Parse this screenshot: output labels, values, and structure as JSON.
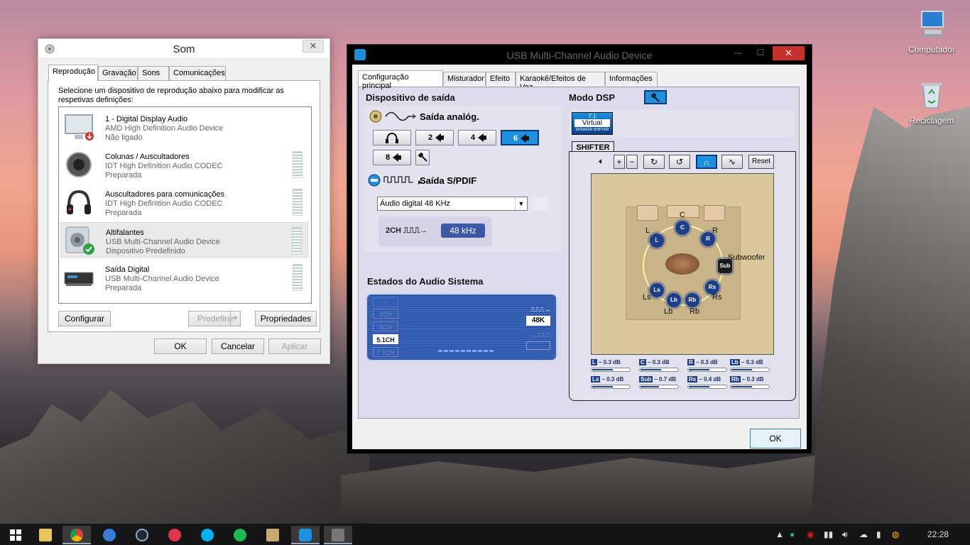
{
  "desktop": {
    "icons": [
      {
        "label": "Computador",
        "icon": "computer-icon"
      },
      {
        "label": "Reciclagem",
        "icon": "recycle-bin-icon"
      }
    ]
  },
  "som": {
    "title": "Som",
    "close": "✕",
    "tabs": [
      "Reprodução",
      "Gravação",
      "Sons",
      "Comunicações"
    ],
    "active_tab": 0,
    "description": "Selecione um dispositivo de reprodução abaixo para modificar as respetivas definições:",
    "devices": [
      {
        "name": "1 - Digital Display Audio",
        "driver": "AMD High Definition Audio Device",
        "status": "Não ligado",
        "icon": "monitor-icon"
      },
      {
        "name": "Colunas / Auscultadores",
        "driver": "IDT High Definition Audio CODEC",
        "status": "Preparada",
        "icon": "speaker-icon"
      },
      {
        "name": "Auscultadores para comunicações",
        "driver": "IDT High Definition Audio CODEC",
        "status": "Preparada",
        "icon": "headphones-icon"
      },
      {
        "name": "Altifalantes",
        "driver": "USB Multi-Channel Audio Device",
        "status": "Dispositivo Predefinido",
        "icon": "speaker-default-icon"
      },
      {
        "name": "Saída Digital",
        "driver": "USB Multi-Channel Audio Device",
        "status": "Preparada",
        "icon": "digital-output-icon"
      }
    ],
    "buttons": {
      "configure": "Configurar",
      "set_default": "Predefinir",
      "properties": "Propriedades",
      "ok": "OK",
      "cancel": "Cancelar",
      "apply": "Aplicar"
    }
  },
  "usb": {
    "title": "USB Multi-Channel Audio Device",
    "tabs": [
      "Configuração principal",
      "Misturador",
      "Efeito",
      "Karaokê/Efeitos de Voz",
      "Informações"
    ],
    "output_device_title": "Dispositivo de saída",
    "analog_label": "Saída analóg.",
    "channel_buttons": [
      "2",
      "4",
      "6",
      "8"
    ],
    "selected_channel": "6",
    "spdif_label": "Saída S/PDIF",
    "spdif_select": "Áudio digital  48 KHz",
    "rate_channels": "2CH",
    "rate_value": "48 kHz",
    "system_state_title": "Estados do Audio Sistema",
    "channel_states": [
      "2CH",
      "4CH",
      "5.1CH",
      "7.1CH"
    ],
    "active_state": "5.1CH",
    "sample_rate_display": "48K",
    "dsp_title": "Modo DSP",
    "virtual_badge": {
      "top": "7.1",
      "mid": "Virtual",
      "bottom": "SPEAKER SHIFTER"
    },
    "shifter_tab": "SHIFTER",
    "reset": "Reset",
    "speakers": {
      "C": "C",
      "L": "L",
      "R": "R",
      "Sub": "Sub",
      "Subwoofer": "Subwoofer",
      "Ls": "Ls",
      "Rs": "Rs",
      "Lb": "Lb",
      "Rb": "Rb"
    },
    "levels": [
      {
        "ch": "L",
        "text": "– 0.3 dB",
        "fill": 0.55
      },
      {
        "ch": "C",
        "text": "– 0.3 dB",
        "fill": 0.55
      },
      {
        "ch": "R",
        "text": "– 0.3 dB",
        "fill": 0.55
      },
      {
        "ch": "Lb",
        "text": "– 0.3 dB",
        "fill": 0.55
      },
      {
        "ch": "Ls",
        "text": "– 0.3 dB",
        "fill": 0.55
      },
      {
        "ch": "Sub",
        "text": "– 0.7 dB",
        "fill": 0.5
      },
      {
        "ch": "Rs",
        "text": "– 0.4 dB",
        "fill": 0.55
      },
      {
        "ch": "Rb",
        "text": "– 0.3 dB",
        "fill": 0.55
      }
    ],
    "ok": "OK"
  },
  "taskbar": {
    "clock": "22:28"
  },
  "colors": {
    "accent": "#1e90e0",
    "close_red": "#c7312b",
    "meter_green": "#b7d3c3"
  }
}
